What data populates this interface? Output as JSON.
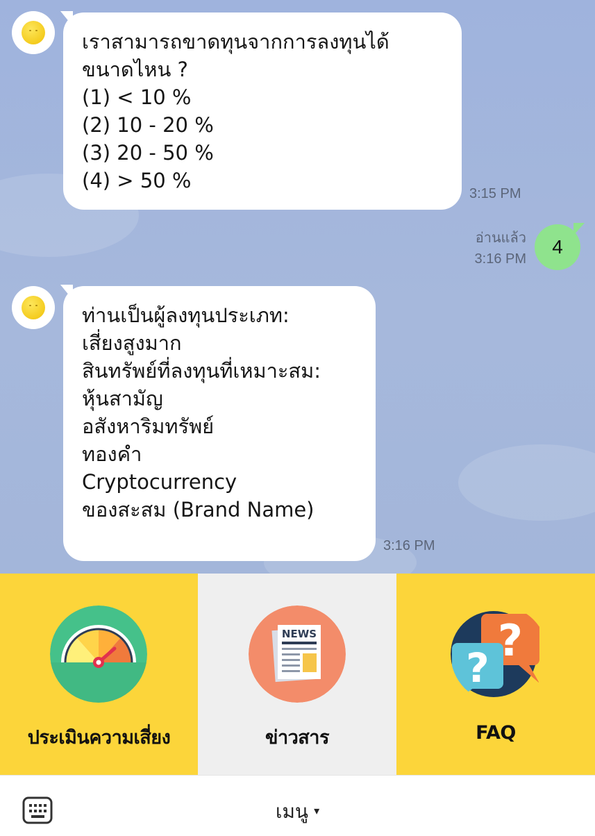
{
  "messages": [
    {
      "sender": "bot",
      "lines": [
        "เราสามารถขาดทุนจากการลงทุนได้",
        "ขนาดไหน ?",
        "(1) < 10 %",
        "(2) 10 - 20 %",
        "(3) 20 - 50 %",
        "(4) > 50 %"
      ],
      "time": "3:15 PM"
    },
    {
      "sender": "user",
      "text": "4",
      "read_label": "อ่านแล้ว",
      "time": "3:16 PM"
    },
    {
      "sender": "bot",
      "lines": [
        "ท่านเป็นผู้ลงทุนประเภท:",
        "เสี่ยงสูงมาก",
        "สินทรัพย์ที่ลงทุนที่เหมาะสม:",
        "หุ้นสามัญ",
        "อสังหาริมทรัพย์",
        "ทองคำ",
        "Cryptocurrency",
        "ของสะสม (Brand Name)"
      ],
      "time": "3:16 PM"
    }
  ],
  "rich_menu": {
    "items": [
      {
        "label": "ประเมินความเสี่ยง",
        "icon": "gauge-icon",
        "bg": "#fcd53a"
      },
      {
        "label": "ข่าวสาร",
        "icon": "newspaper-icon",
        "icon_text": "NEWS",
        "bg": "#efefef"
      },
      {
        "label": "FAQ",
        "icon": "question-bubbles-icon",
        "bg": "#fcd53a"
      }
    ]
  },
  "footer": {
    "keyboard_icon": "keyboard-icon",
    "menu_label": "เมนู",
    "caret": "▾"
  },
  "colors": {
    "chat_bg": "#a4b6dc",
    "user_bubble": "#8fe38d",
    "menu_yellow": "#fcd53a",
    "menu_gray": "#efefef"
  }
}
